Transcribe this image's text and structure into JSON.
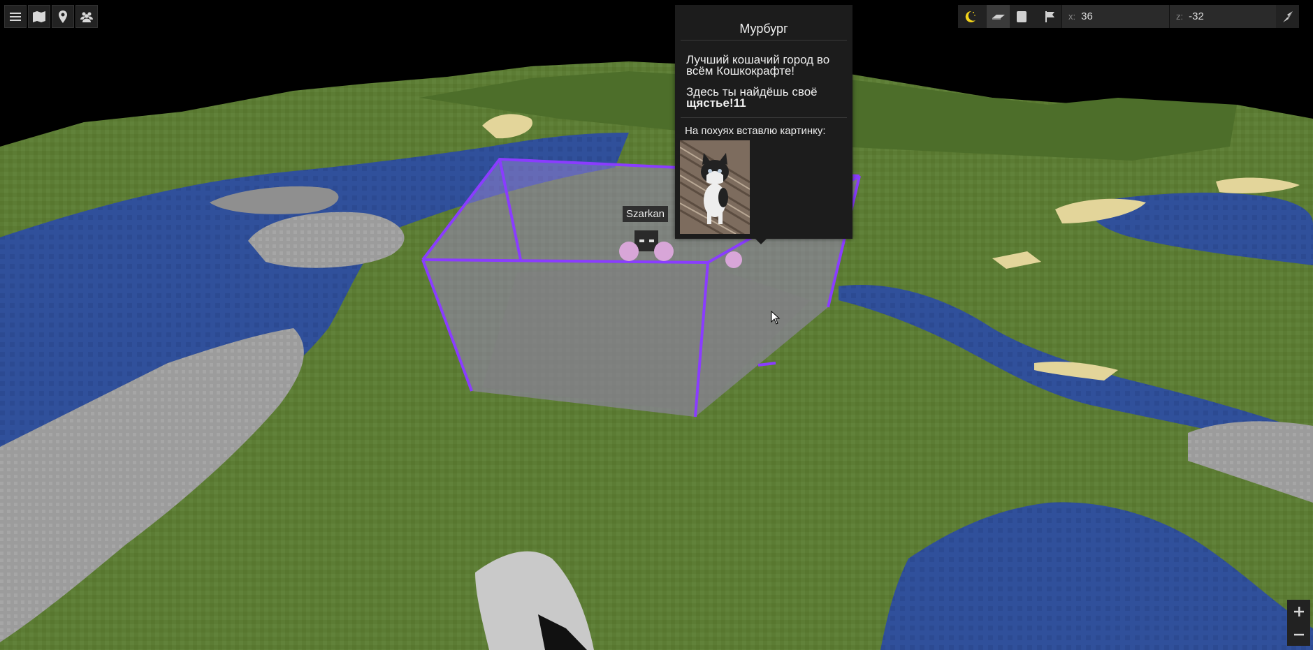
{
  "toolbar_left": {
    "icons": [
      "menu-icon",
      "map-icon",
      "marker-icon",
      "players-icon"
    ]
  },
  "toolbar_right": {
    "icons": [
      "moon-icon",
      "flat-view-icon",
      "free-view-icon",
      "flag-icon",
      "compass-icon"
    ],
    "x_label": "x:",
    "x_value": "36",
    "z_label": "z:",
    "z_value": "-32"
  },
  "popup": {
    "title": "Мурбург",
    "line1": "Лучший кошачий город во всём Кошкокрафте!",
    "line2_regular": "Здесь ты найдёшь своё ",
    "line2_bold": "щястье!11",
    "caption": "На похуях вставлю картинку:"
  },
  "player": {
    "name": "Szarkan"
  },
  "zoom": {
    "icons": [
      "zoom-in-icon",
      "zoom-out-icon"
    ]
  },
  "colors": {
    "grass": "#5a7a32",
    "water": "#2f4f9a",
    "stone": "#9a9a9a",
    "sand": "#e6d9a0",
    "region_border": "#8a3cff",
    "region_fill": "#a78ad6"
  }
}
